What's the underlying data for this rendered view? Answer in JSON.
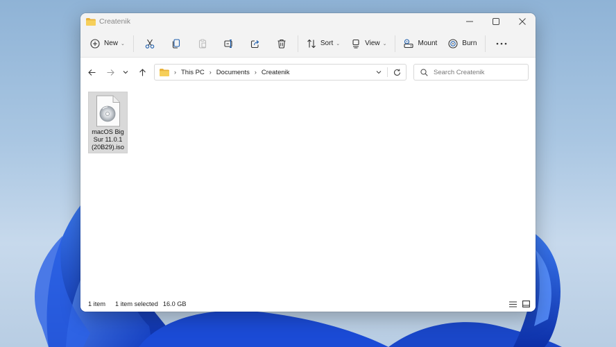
{
  "window": {
    "title": "Createnik"
  },
  "toolbar": {
    "new_label": "New",
    "sort_label": "Sort",
    "view_label": "View",
    "mount_label": "Mount",
    "burn_label": "Burn"
  },
  "address": {
    "crumbs": [
      "This PC",
      "Documents",
      "Createnik"
    ]
  },
  "search": {
    "placeholder": "Search Createnik"
  },
  "files": [
    {
      "name": "macOS Big Sur 11.0.1 (20B29).iso",
      "line1": "macOS Big",
      "line2": "Sur 11.0.1",
      "line3": "(20B29).iso",
      "icon": "disc-image-icon"
    }
  ],
  "status": {
    "count": "1 item",
    "selected": "1 item selected",
    "size": "16.0 GB"
  },
  "colors": {
    "folder": "#f2c74a",
    "accent": "#0b5cad",
    "wallpaper_blue": "#1a4fd1"
  }
}
